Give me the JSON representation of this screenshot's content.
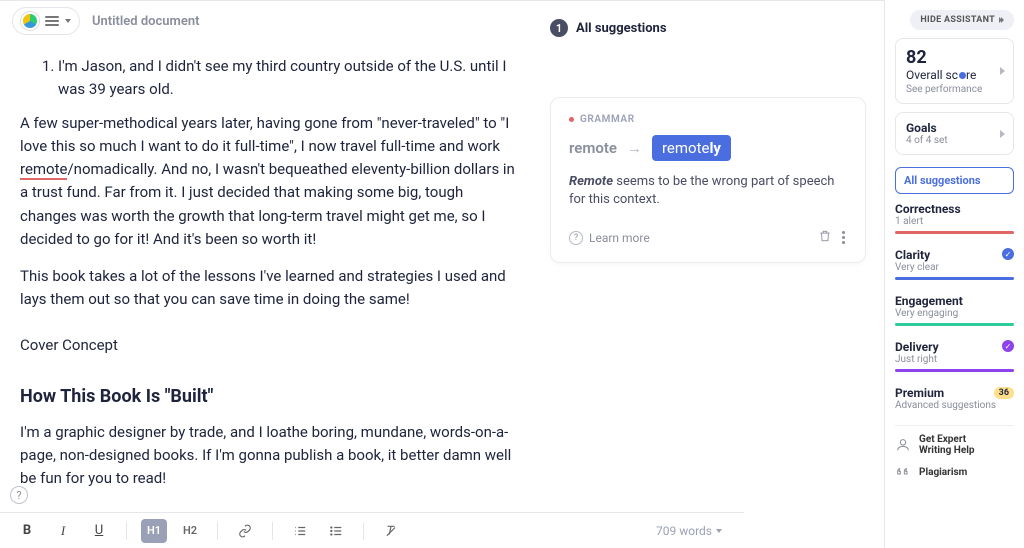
{
  "header": {
    "doc_title": "Untitled document"
  },
  "editor": {
    "list_item": "I'm Jason, and I didn't see my third country outside of the U.S. until I was 39 years old.",
    "para1_a": "A few super-methodical years later, having gone from \"never-traveled\" to \"I love this so much I want to do it full-time\", I now travel full-time and work ",
    "flagged": "remote",
    "para1_b": "/nomadically. And no, I wasn't bequeathed eleventy-billion dollars in a trust fund. Far from it. I just decided that making some big, tough changes was worth the growth that long-term travel might get me, so I decided to go for it! And it's been so worth it!",
    "para2": "This book takes a lot of the lessons I've learned and strategies I used and lays them out so that you can save time in doing the same!",
    "cover": "Cover Concept",
    "h2": "How This Book Is \"Built\"",
    "para3": "I'm a graphic designer by trade, and I loathe boring, mundane, words-on-a-page, non-designed books. If I'm gonna publish a book, it better damn well be fun for you to read!"
  },
  "toolbar": {
    "b": "B",
    "i": "I",
    "u": "U",
    "h1": "H1",
    "h2": "H2",
    "wordcount": "709 words"
  },
  "suggestions": {
    "count": "1",
    "header": "All suggestions",
    "card": {
      "category": "GRAMMAR",
      "old": "remote",
      "new_base": "remote",
      "new_bold": "ly",
      "msg_em": "Remote",
      "msg_rest": " seems to be the wrong part of speech for this context.",
      "learn": "Learn more"
    }
  },
  "sidebar": {
    "hide": "HIDE ASSISTANT",
    "score_num": "82",
    "score_label_a": "Overall sc",
    "score_label_b": "re",
    "score_sub": "See performance",
    "goals_t": "Goals",
    "goals_s": "4 of 4 set",
    "all_sugg": "All suggestions",
    "metrics": {
      "correctness": {
        "t": "Correctness",
        "s": "1 alert",
        "color": "#e06666"
      },
      "clarity": {
        "t": "Clarity",
        "s": "Very clear",
        "color": "#4a6ee0"
      },
      "engagement": {
        "t": "Engagement",
        "s": "Very engaging",
        "color": "#2ecc9a"
      },
      "delivery": {
        "t": "Delivery",
        "s": "Just right",
        "color": "#8e44ec"
      }
    },
    "premium_t": "Premium",
    "premium_s": "Advanced suggestions",
    "premium_n": "36",
    "expert_a": "Get Expert",
    "expert_b": "Writing Help",
    "plag": "Plagiarism"
  }
}
